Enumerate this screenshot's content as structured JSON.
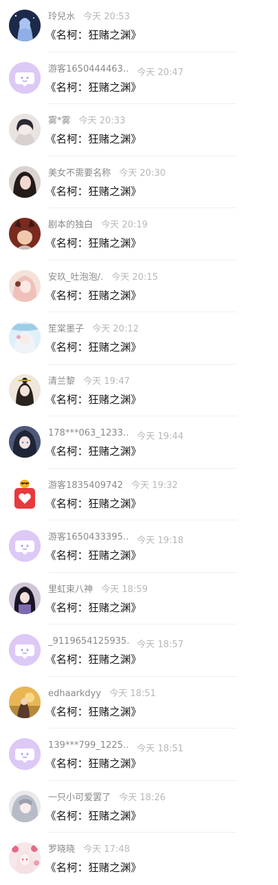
{
  "comments": [
    {
      "name": "玲兒水",
      "time": "今天 20:53",
      "message": "《名柯：狂赌之渊》",
      "avatar": "anime-girl-blue-avatar"
    },
    {
      "name": "游客1650444463…",
      "time": "今天 20:47",
      "message": "《名柯：狂赌之渊》",
      "avatar": "guest-chat-bubble-avatar"
    },
    {
      "name": "雾*雾",
      "time": "今天 20:33",
      "message": "《名柯：狂赌之渊》",
      "avatar": "anime-boy-avatar"
    },
    {
      "name": "美女不需要名称",
      "time": "今天 20:30",
      "message": "《名柯：狂赌之渊》",
      "avatar": "girl-photo-avatar"
    },
    {
      "name": "剧本的独白",
      "time": "今天 20:19",
      "message": "《名柯：狂赌之渊》",
      "avatar": "cat-ears-avatar"
    },
    {
      "name": "安玖_吐泡泡/.",
      "time": "今天 20:15",
      "message": "《名柯：狂赌之渊》",
      "avatar": "pink-hair-avatar"
    },
    {
      "name": "笙棠墨子",
      "time": "今天 20:12",
      "message": "《名柯：狂赌之渊》",
      "avatar": "white-hair-girl-avatar"
    },
    {
      "name": "清兰黎",
      "time": "今天 19:47",
      "message": "《名柯：狂赌之渊》",
      "avatar": "ancient-style-girl-avatar"
    },
    {
      "name": "178***063_1233…",
      "time": "今天 19:44",
      "message": "《名柯：狂赌之渊》",
      "avatar": "dark-hair-anime-avatar"
    },
    {
      "name": "游客1835409742",
      "time": "今天 19:32",
      "message": "《名柯：狂赌之渊》",
      "avatar": "bee-heart-avatar"
    },
    {
      "name": "游客1650433395…",
      "time": "今天 19:18",
      "message": "《名柯：狂赌之渊》",
      "avatar": "guest-chat-bubble-avatar"
    },
    {
      "name": "里虹束八神",
      "time": "今天 18:59",
      "message": "《名柯：狂赌之渊》",
      "avatar": "long-hair-girl-avatar"
    },
    {
      "name": "_9119654125935…",
      "time": "今天 18:57",
      "message": "《名柯：狂赌之渊》",
      "avatar": "guest-chat-bubble-avatar"
    },
    {
      "name": "edhaarkdyy",
      "time": "今天 18:51",
      "message": "《名柯：狂赌之渊》",
      "avatar": "sunset-girl-avatar"
    },
    {
      "name": "139***799_1225…",
      "time": "今天 18:51",
      "message": "《名柯：狂赌之渊》",
      "avatar": "guest-chat-bubble-avatar"
    },
    {
      "name": "一只小可爱罢了",
      "time": "今天 18:26",
      "message": "《名柯：狂赌之渊》",
      "avatar": "gray-hair-avatar"
    },
    {
      "name": "罗晓晓",
      "time": "今天 17:48",
      "message": "《名柯：狂赌之渊》",
      "avatar": "flower-girl-avatar"
    }
  ],
  "colors": {
    "name": "#8a8a8a",
    "time": "#b8b8b8",
    "message": "#1a1a1a",
    "guest_avatar_bg": "#dcc9f6",
    "heart_red": "#e8393c",
    "bee_yellow": "#f6b01c"
  }
}
